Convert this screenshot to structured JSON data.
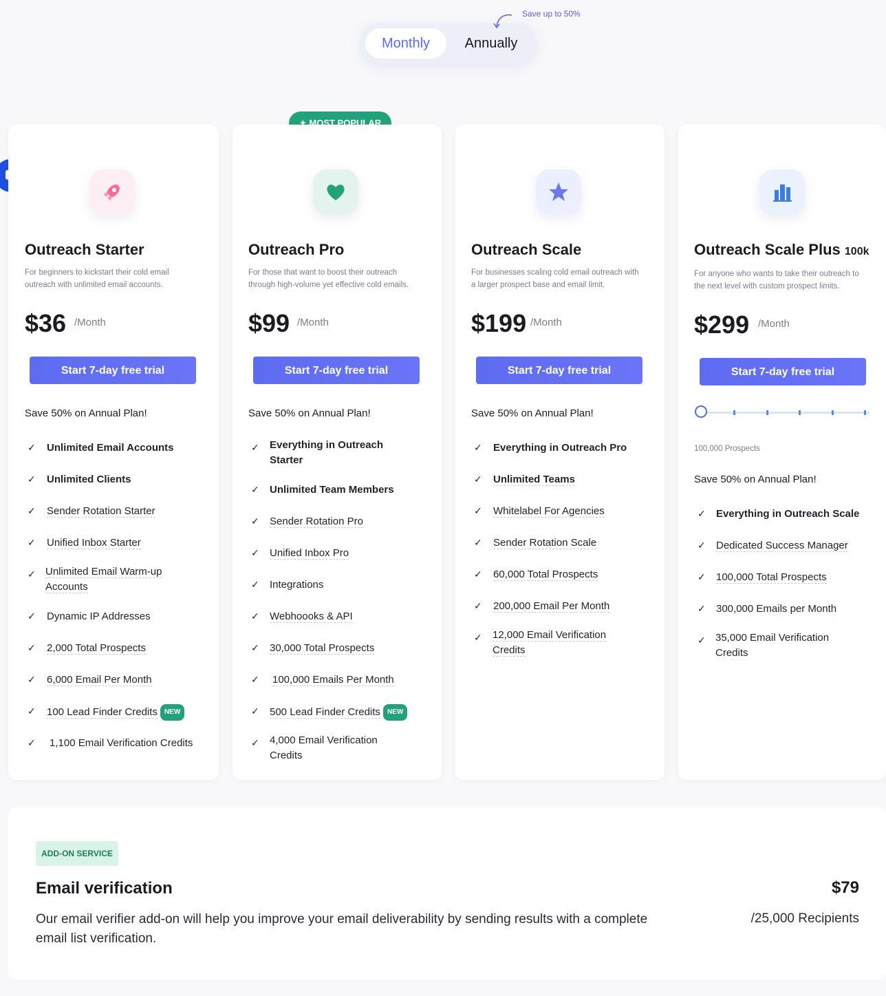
{
  "billing_toggle": {
    "monthly": "Monthly",
    "annually": "Annually",
    "save_note": "Save up to 50%",
    "selected": "Monthly"
  },
  "popular_badge": "MOST POPULAR",
  "plans": [
    {
      "name": "Outreach Starter",
      "description": "For beginners to kickstart their cold email outreach with unlimited email accounts.",
      "price": "$36",
      "period": "/Month",
      "cta": "Start 7-day free trial",
      "save_note": "Save 50% on Annual Plan!",
      "icon": "rocket-icon",
      "icon_color": "#f56e9b",
      "features": [
        {
          "label": "Unlimited Email Accounts"
        },
        {
          "label": "Unlimited Clients"
        },
        {
          "label": "Sender Rotation Starter"
        },
        {
          "label": "Unified Inbox Starter"
        },
        {
          "label": "Unlimited Email Warm-up Accounts"
        },
        {
          "label": "Dynamic IP Addresses"
        },
        {
          "label": "2,000 Total Prospects"
        },
        {
          "label": "6,000 Email Per Month"
        },
        {
          "label": "100 Lead Finder Credits",
          "badge": "NEW"
        },
        {
          "label": "1,100 Email Verification Credits"
        }
      ]
    },
    {
      "name": "Outreach Pro",
      "description": "For those that want to boost their outreach through high-volume yet effective cold emails.",
      "price": "$99",
      "period": "/Month",
      "cta": "Start 7-day free trial",
      "save_note": "Save 50% on Annual Plan!",
      "icon": "heart-icon",
      "icon_color": "#22a27a",
      "features": [
        {
          "label": "Everything in Outreach Starter"
        },
        {
          "label": "Unlimited Team Members"
        },
        {
          "label": "Sender Rotation Pro"
        },
        {
          "label": "Unified Inbox Pro"
        },
        {
          "label": "Integrations"
        },
        {
          "label": "Webhoooks & API"
        },
        {
          "label": "30,000 Total Prospects"
        },
        {
          "label": "100,000 Emails Per Month"
        },
        {
          "label": "500 Lead Finder Credits",
          "badge": "NEW"
        },
        {
          "label": "4,000 Email Verification Credits"
        }
      ]
    },
    {
      "name": "Outreach Scale",
      "description": "For businesses scaling cold email outreach with a larger prospect base and email limit.",
      "price": "$199",
      "period": "/Month",
      "cta": "Start 7-day free trial",
      "save_note": "Save 50% on Annual Plan!",
      "icon": "star-icon",
      "icon_color": "#6b78ee",
      "features": [
        {
          "label": "Everything in Outreach Pro"
        },
        {
          "label": "Unlimited Teams"
        },
        {
          "label": "Whitelabel For Agencies"
        },
        {
          "label": "Sender Rotation Scale"
        },
        {
          "label": "60,000 Total Prospects"
        },
        {
          "label": "200,000 Email Per Month"
        },
        {
          "label": "12,000 Email Verification Credits"
        }
      ]
    },
    {
      "name": "Outreach Scale Plus",
      "name_suffix": "100k",
      "description": "For anyone who wants to take their outreach to the next level with custom prospect limits.",
      "price": "$299",
      "period": "/Month",
      "cta": "Start 7-day free trial",
      "save_note": "Save 50% on Annual Plan!",
      "icon": "building-icon",
      "icon_color": "#3d7de0",
      "slider_label": "100,000 Prospects",
      "slider_level": 0.0,
      "features": [
        {
          "label": "Everything in Outreach Scale"
        },
        {
          "label": "Dedicated Success Manager"
        },
        {
          "label": "100,000 Total Prospects"
        },
        {
          "label": "300,000 Emails per Month"
        },
        {
          "label": "35,000 Email Verification Credits"
        }
      ]
    }
  ],
  "addon": {
    "badge": "ADD-ON SERVICE",
    "title": "Email verification",
    "description": "Our email verifier add-on will help you improve your email deliverability by sending results with a complete email list verification.",
    "price": "$79",
    "per": "/25,000 Recipients"
  },
  "chat_widget": {
    "icon": "chat-icon"
  }
}
